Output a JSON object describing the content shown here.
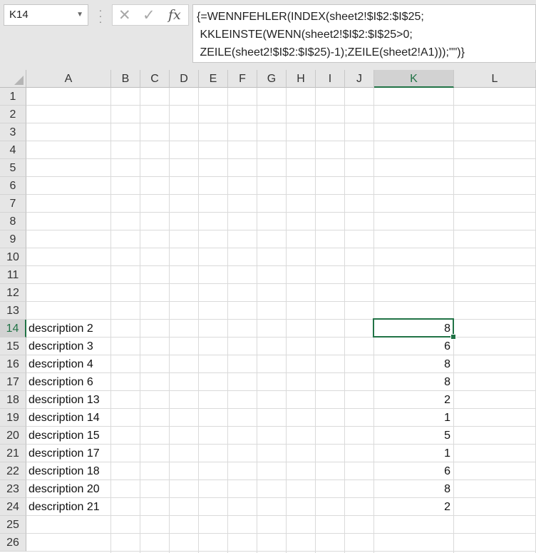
{
  "name_box": {
    "value": "K14"
  },
  "formula_bar": {
    "lines": [
      "{=WENNFEHLER(INDEX(sheet2!$I$2:$I$25;",
      " KKLEINSTE(WENN(sheet2!$I$2:$I$25>0;",
      " ZEILE(sheet2!$I$2:$I$25)-1);ZEILE(sheet2!A1)));\"\")}"
    ],
    "cancel_icon": "x-icon",
    "enter_icon": "check-icon",
    "function_icon": "fx-icon"
  },
  "columns": [
    "A",
    "B",
    "C",
    "D",
    "E",
    "F",
    "G",
    "H",
    "I",
    "J",
    "K",
    "L"
  ],
  "rows": [
    "1",
    "2",
    "3",
    "4",
    "5",
    "6",
    "7",
    "8",
    "9",
    "10",
    "11",
    "12",
    "13",
    "14",
    "15",
    "16",
    "17",
    "18",
    "19",
    "20",
    "21",
    "22",
    "23",
    "24",
    "25",
    "26"
  ],
  "selected": {
    "column": "K",
    "row": "14"
  },
  "data_rows": [
    {
      "row": "14",
      "a": "description 2",
      "k": "8"
    },
    {
      "row": "15",
      "a": "description 3",
      "k": "6"
    },
    {
      "row": "16",
      "a": "description 4",
      "k": "8"
    },
    {
      "row": "17",
      "a": "description 6",
      "k": "8"
    },
    {
      "row": "18",
      "a": "description 13",
      "k": "2"
    },
    {
      "row": "19",
      "a": "description 14",
      "k": "1"
    },
    {
      "row": "20",
      "a": "description 15",
      "k": "5"
    },
    {
      "row": "21",
      "a": "description 17",
      "k": "1"
    },
    {
      "row": "22",
      "a": "description 18",
      "k": "6"
    },
    {
      "row": "23",
      "a": "description 20",
      "k": "8"
    },
    {
      "row": "24",
      "a": "description 21",
      "k": "2"
    }
  ],
  "colors": {
    "accent": "#217346",
    "header_bg": "#e6e6e6",
    "grid_line": "#dadada"
  }
}
